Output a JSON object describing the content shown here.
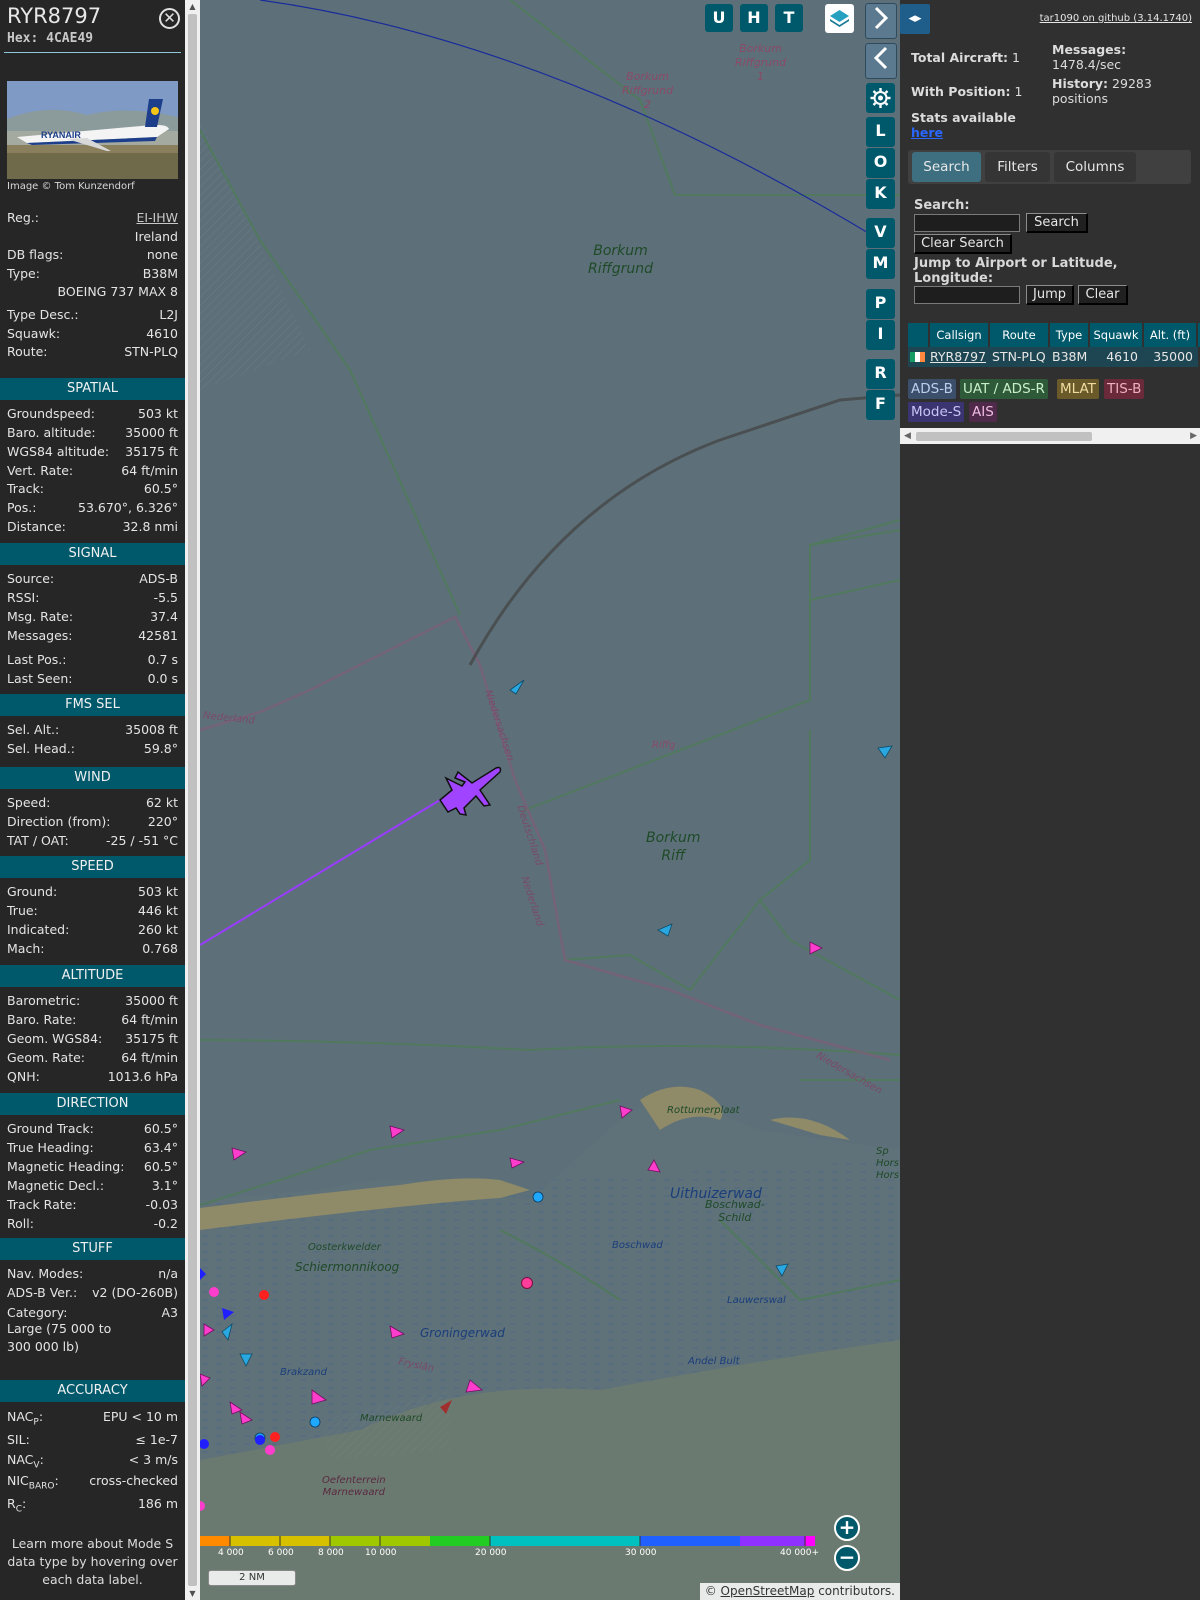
{
  "infoblock": {
    "callsign": "RYR8797",
    "hex": "Hex: 4CAE49",
    "close_icon": "close-circle-icon",
    "photo_alt": "RYANAIR",
    "photo_credit": "Image © Tom Kunzendorf",
    "registration_label": "Reg.:",
    "registration": "EI-IHW",
    "country": "Ireland",
    "dbflags_label": "DB flags:",
    "dbflags": "none",
    "type_label": "Type:",
    "type": "B38M",
    "type_name": "BOEING 737 MAX 8",
    "typedesc_label": "Type Desc.:",
    "typedesc": "L2J",
    "squawk_label": "Squawk:",
    "squawk": "4610",
    "route_label": "Route:",
    "route": "STN-PLQ"
  },
  "sections": {
    "spatial": {
      "title": "SPATIAL",
      "rows": [
        {
          "label": "Groundspeed:",
          "value": "503 kt"
        },
        {
          "label": "Baro. altitude:",
          "value": "35000 ft"
        },
        {
          "label": "WGS84 altitude:",
          "value": "35175 ft"
        },
        {
          "label": "Vert. Rate:",
          "value": "64 ft/min"
        },
        {
          "label": "Track:",
          "value": "60.5°"
        },
        {
          "label": "Pos.:",
          "value": "53.670°, 6.326°"
        },
        {
          "label": "Distance:",
          "value": "32.8 nmi"
        }
      ]
    },
    "signal": {
      "title": "SIGNAL",
      "rows": [
        {
          "label": "Source:",
          "value": "ADS-B"
        },
        {
          "label": "RSSI:",
          "value": "-5.5"
        },
        {
          "label": "Msg. Rate:",
          "value": "37.4"
        },
        {
          "label": "Messages:",
          "value": "42581"
        },
        {
          "label": "Last Pos.:",
          "value": "0.7 s"
        },
        {
          "label": "Last Seen:",
          "value": "0.0 s"
        }
      ]
    },
    "fms": {
      "title": "FMS SEL",
      "rows": [
        {
          "label": "Sel. Alt.:",
          "value": "35008 ft"
        },
        {
          "label": "Sel. Head.:",
          "value": "59.8°"
        }
      ]
    },
    "wind": {
      "title": "WIND",
      "rows": [
        {
          "label": "Speed:",
          "value": "62 kt"
        },
        {
          "label": "Direction (from):",
          "value": "220°"
        },
        {
          "label": "TAT / OAT:",
          "value": "-25 / -51 °C"
        }
      ]
    },
    "speed": {
      "title": "SPEED",
      "rows": [
        {
          "label": "Ground:",
          "value": "503 kt"
        },
        {
          "label": "True:",
          "value": "446 kt"
        },
        {
          "label": "Indicated:",
          "value": "260 kt"
        },
        {
          "label": "Mach:",
          "value": "0.768"
        }
      ]
    },
    "altitude": {
      "title": "ALTITUDE",
      "rows": [
        {
          "label": "Barometric:",
          "value": "35000 ft"
        },
        {
          "label": "Baro. Rate:",
          "value": "64 ft/min"
        },
        {
          "label": "Geom. WGS84:",
          "value": "35175 ft"
        },
        {
          "label": "Geom. Rate:",
          "value": "64 ft/min"
        },
        {
          "label": "QNH:",
          "value": "1013.6 hPa"
        }
      ]
    },
    "direction": {
      "title": "DIRECTION",
      "rows": [
        {
          "label": "Ground Track:",
          "value": "60.5°"
        },
        {
          "label": "True Heading:",
          "value": "63.4°"
        },
        {
          "label": "Magnetic Heading:",
          "value": "60.5°"
        },
        {
          "label": "Magnetic Decl.:",
          "value": "3.1°"
        },
        {
          "label": "Track Rate:",
          "value": "-0.03"
        },
        {
          "label": "Roll:",
          "value": "-0.2"
        }
      ]
    },
    "stuff": {
      "title": "STUFF",
      "rows": [
        {
          "label": "Nav. Modes:",
          "value": "n/a"
        },
        {
          "label": "ADS-B Ver.:",
          "value": "v2 (DO-260B)"
        },
        {
          "label": "Category:",
          "value": "A3"
        }
      ],
      "category_desc_1": "Large (75 000 to",
      "category_desc_2": "300 000 lb)"
    },
    "accuracy": {
      "title": "ACCURACY",
      "nacp_main": "NAC",
      "nacp_sub": "P",
      "nacp_value": "EPU < 10 m",
      "sil_label": "SIL:",
      "sil_value": "≤ 1e-7",
      "nacv_main": "NAC",
      "nacv_sub": "V",
      "nacv_value": "< 3 m/s",
      "nicbaro_main": "NIC",
      "nicbaro_sub": "BARO",
      "nicbaro_value": "cross-checked",
      "rc_main": "R",
      "rc_sub": "C",
      "rc_value": "186 m"
    },
    "footer_1": "Learn more about Mode S",
    "footer_2": "data type by hovering over",
    "footer_3": "each data label."
  },
  "map": {
    "buttons_top": [
      "U",
      "H",
      "T"
    ],
    "layers_icon": "layers-icon",
    "settings_icon": "gear-icon",
    "side_buttons": [
      "L",
      "O",
      "K",
      "V",
      "M",
      "P",
      "I",
      "R",
      "F"
    ],
    "expand_icon": "chevron-right-icon",
    "collapse_icon": "chevron-left-icon",
    "labels": {
      "borkum_riffgrund_1": [
        "Borkum",
        "Riffgrund",
        "1"
      ],
      "borkum_riffgrund_2": [
        "Borkum",
        "Riffgrund",
        "2"
      ],
      "borkum_riffgrund": [
        "Borkum",
        "Riffgrund"
      ],
      "borkum_riff": [
        "Borkum",
        "Riff"
      ],
      "nederland": "Nederland",
      "niedersachsen": "Niedersachsen",
      "deutschland": "Deutschland",
      "nederland2": "Nederland",
      "riffg": "Riffg",
      "niedersachsen2": "Niedersachsen",
      "rottumerplaat": "Rottumerplaat",
      "uithuizerwad": "Uithuizerwad",
      "boschwad_schild": [
        "Boschwad-",
        "Schild"
      ],
      "boschwad": "Boschwad",
      "oosterkwelder": "Oosterkwelder",
      "schiermonnikoog": "Schiermonnikoog",
      "groningerwad": "Groningerwad",
      "lauwerswal": "Lauwerswal",
      "brakzand": "Brakzand",
      "fryslan": "Fryslân",
      "andel_bult": "Andel Bult",
      "marnewaard": "Marnewaard",
      "oefenterrein": [
        "Oefenterrein",
        "Marnewaard"
      ],
      "spo": [
        "Sp",
        "Hors",
        "Hors"
      ]
    },
    "altitude_ticks": [
      "4 000",
      "6 000",
      "8 000",
      "10 000",
      "20 000",
      "30 000",
      "40 000+"
    ],
    "scale": "2 NM",
    "zoom_in": "+",
    "zoom_out": "−",
    "attribution_prefix": "© ",
    "attribution_link": "OpenStreetMap",
    "attribution_suffix": " contributors."
  },
  "panel": {
    "toggle_icon": "left-right-arrows-icon",
    "github_link": "tar1090 on github (3.14.1740)",
    "total_aircraft_label": "Total Aircraft:",
    "total_aircraft": "1",
    "with_position_label": "With Position:",
    "with_position": "1",
    "messages_label": "Messages:",
    "messages_value": "1478.4/sec",
    "history_label": "History:",
    "history_value_1": "29283",
    "history_value_2": "positions",
    "stats_label": "Stats available",
    "stats_link": "here",
    "tabs": [
      "Search",
      "Filters",
      "Columns"
    ],
    "search_label": "Search:",
    "search_button": "Search",
    "clear_search_button": "Clear Search",
    "jump_label_1": "Jump to Airport or Latitude,",
    "jump_label_2": "Longitude:",
    "jump_button": "Jump",
    "clear_button": "Clear",
    "table_headers": [
      "Callsign",
      "Route",
      "Type",
      "Squawk",
      "Alt. (ft)"
    ],
    "table_row": {
      "callsign": "RYR8797",
      "route": "STN-PLQ",
      "type": "B38M",
      "squawk": "4610",
      "altitude": "35000"
    },
    "legend": [
      {
        "label": "ADS-B",
        "color": "#3b4f6b"
      },
      {
        "label": "UAT / ADS-R",
        "color": "#2f5a3a"
      },
      {
        "label": "MLAT",
        "color": "#6a5a2a"
      },
      {
        "label": "TIS-B",
        "color": "#6a2a3a"
      },
      {
        "label": "Mode-S",
        "color": "#3a3570"
      },
      {
        "label": "AIS",
        "color": "#4f2a4a"
      }
    ]
  }
}
